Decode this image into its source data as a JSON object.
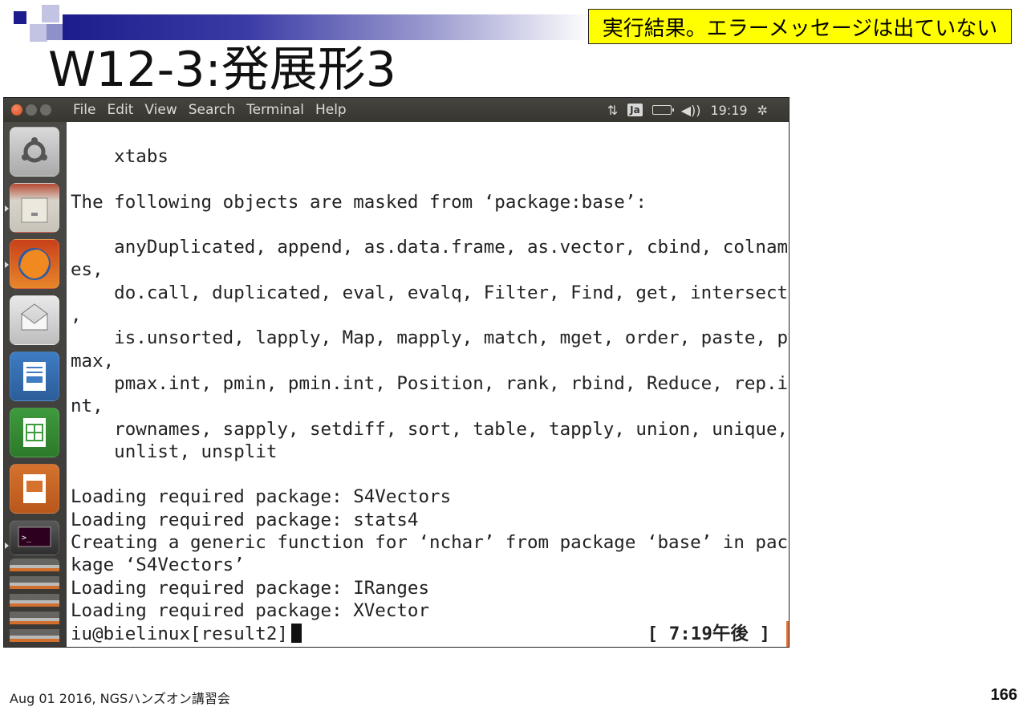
{
  "slide": {
    "note": "実行結果。エラーメッセージは出ていない",
    "title": "W12-3:発展形3",
    "footer": "Aug 01 2016, NGSハンズオン講習会",
    "page_number": "166"
  },
  "window": {
    "menu": [
      "File",
      "Edit",
      "View",
      "Search",
      "Terminal",
      "Help"
    ],
    "indicators": {
      "input_method": "Ja",
      "clock": "19:19"
    }
  },
  "launcher": [
    {
      "name": "dash-home"
    },
    {
      "name": "files"
    },
    {
      "name": "firefox"
    },
    {
      "name": "mail"
    },
    {
      "name": "libreoffice-writer"
    },
    {
      "name": "libreoffice-calc"
    },
    {
      "name": "libreoffice-impress"
    },
    {
      "name": "terminal"
    }
  ],
  "terminal": {
    "lines": [
      "    xtabs",
      "",
      "The following objects are masked from ‘package:base’:",
      "",
      "    anyDuplicated, append, as.data.frame, as.vector, cbind, colnam",
      "es,",
      "    do.call, duplicated, eval, evalq, Filter, Find, get, intersect",
      ",",
      "    is.unsorted, lapply, Map, mapply, match, mget, order, paste, p",
      "max,",
      "    pmax.int, pmin, pmin.int, Position, rank, rbind, Reduce, rep.i",
      "nt,",
      "    rownames, sapply, setdiff, sort, table, tapply, union, unique,",
      "    unlist, unsplit",
      "",
      "Loading required package: S4Vectors",
      "Loading required package: stats4",
      "Creating a generic function for ‘nchar’ from package ‘base’ in pac",
      "kage ‘S4Vectors’",
      "Loading required package: IRanges",
      "Loading required package: XVector"
    ],
    "prompt": "iu@bielinux[result2]",
    "prompt_time": "[ 7:19午後 ]"
  },
  "colors": {
    "note_bg": "#ffff00",
    "close_button": "#e0572b",
    "terminal_bg": "#ffffff",
    "panel_bg": "#3c3b37"
  }
}
